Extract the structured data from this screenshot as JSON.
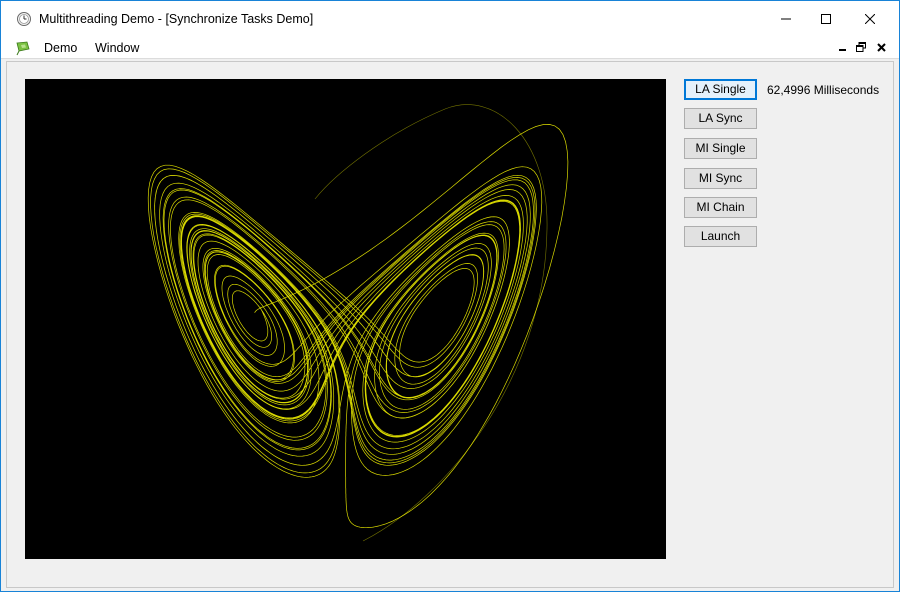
{
  "window": {
    "title": "Multithreading Demo - [Synchronize Tasks Demo]"
  },
  "menu": {
    "items": [
      "Demo",
      "Window"
    ]
  },
  "panel": {
    "buttons": [
      {
        "label": "LA Single",
        "default": true
      },
      {
        "label": "LA Sync",
        "default": false
      },
      {
        "label": "MI Single",
        "default": false
      },
      {
        "label": "MI Sync",
        "default": false
      },
      {
        "label": "MI Chain",
        "default": false
      },
      {
        "label": "Launch",
        "default": false
      }
    ],
    "timing_text": "62,4996 Milliseconds"
  },
  "canvas": {
    "background": "#000000",
    "stroke_color": "#ffff00",
    "content": "lorenz-attractor"
  },
  "colors": {
    "window_border": "#1883d7",
    "client_bg": "#f0f0f0",
    "default_button_border": "#0078d7"
  }
}
